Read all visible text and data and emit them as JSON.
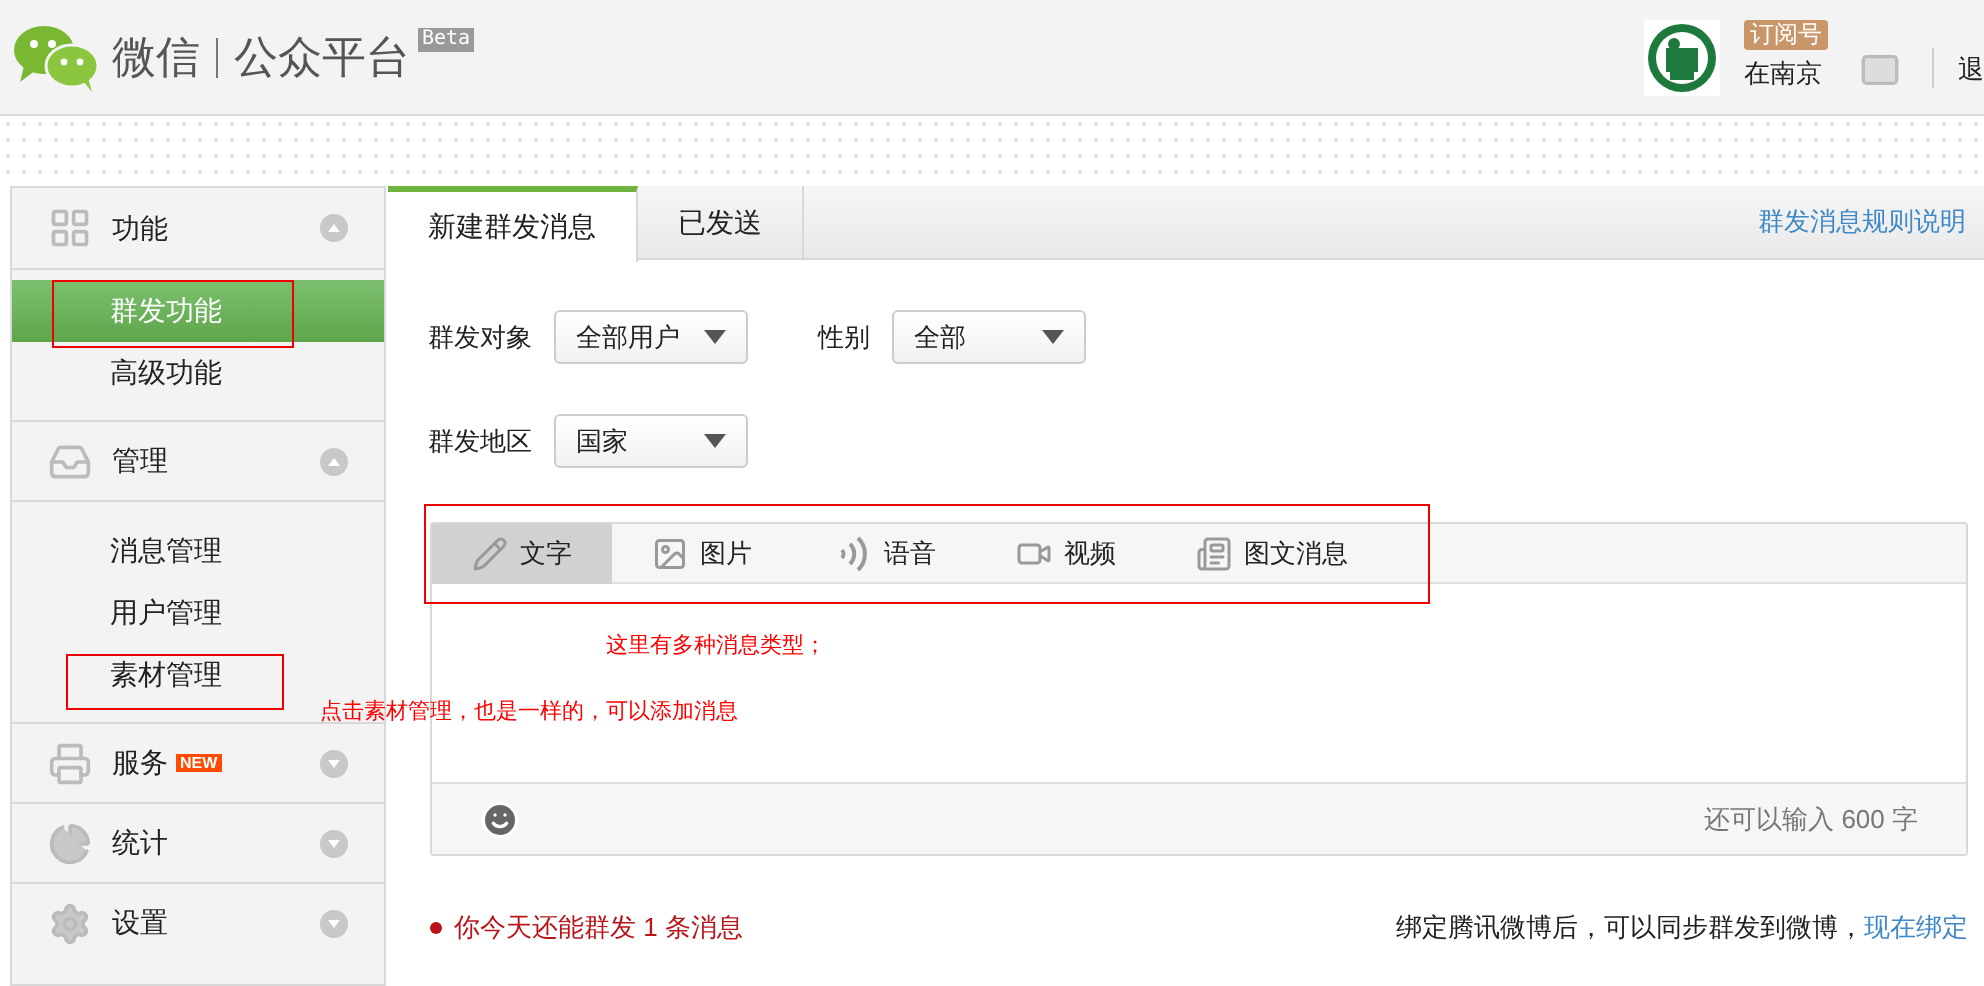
{
  "header": {
    "logo_text": "微信",
    "platform": "公众平台",
    "beta": "Beta",
    "account_type": "订阅号",
    "account_name": "在南京",
    "logout": "退"
  },
  "sidebar": {
    "sections": [
      {
        "label": "功能",
        "expanded": true,
        "items": [
          {
            "label": "群发功能",
            "selected": true
          },
          {
            "label": "高级功能",
            "selected": false
          }
        ]
      },
      {
        "label": "管理",
        "expanded": true,
        "items": [
          {
            "label": "消息管理",
            "selected": false
          },
          {
            "label": "用户管理",
            "selected": false
          },
          {
            "label": "素材管理",
            "selected": false
          }
        ]
      },
      {
        "label": "服务",
        "expanded": false,
        "badge": "NEW"
      },
      {
        "label": "统计",
        "expanded": false
      },
      {
        "label": "设置",
        "expanded": false
      }
    ]
  },
  "tabs": [
    {
      "label": "新建群发消息",
      "selected": true
    },
    {
      "label": "已发送",
      "selected": false
    }
  ],
  "rules_link": "群发消息规则说明",
  "filters": [
    [
      {
        "label": "群发对象",
        "value": "全部用户"
      },
      {
        "label": "性别",
        "value": "全部"
      }
    ],
    [
      {
        "label": "群发地区",
        "value": "国家"
      }
    ]
  ],
  "message_types": [
    {
      "label": "文字",
      "selected": true
    },
    {
      "label": "图片",
      "selected": false
    },
    {
      "label": "语音",
      "selected": false
    },
    {
      "label": "视频",
      "selected": false
    },
    {
      "label": "图文消息",
      "selected": false
    }
  ],
  "char_counter": "还可以输入 600 字",
  "quota": "你今天还能群发 1 条消息",
  "weibo_note": "绑定腾讯微博后，可以同步群发到微博，",
  "weibo_link": "现在绑定",
  "annotations": [
    {
      "text": "这里有多种消息类型；"
    },
    {
      "text": "点击素材管理，也是一样的，可以添加消息"
    }
  ]
}
